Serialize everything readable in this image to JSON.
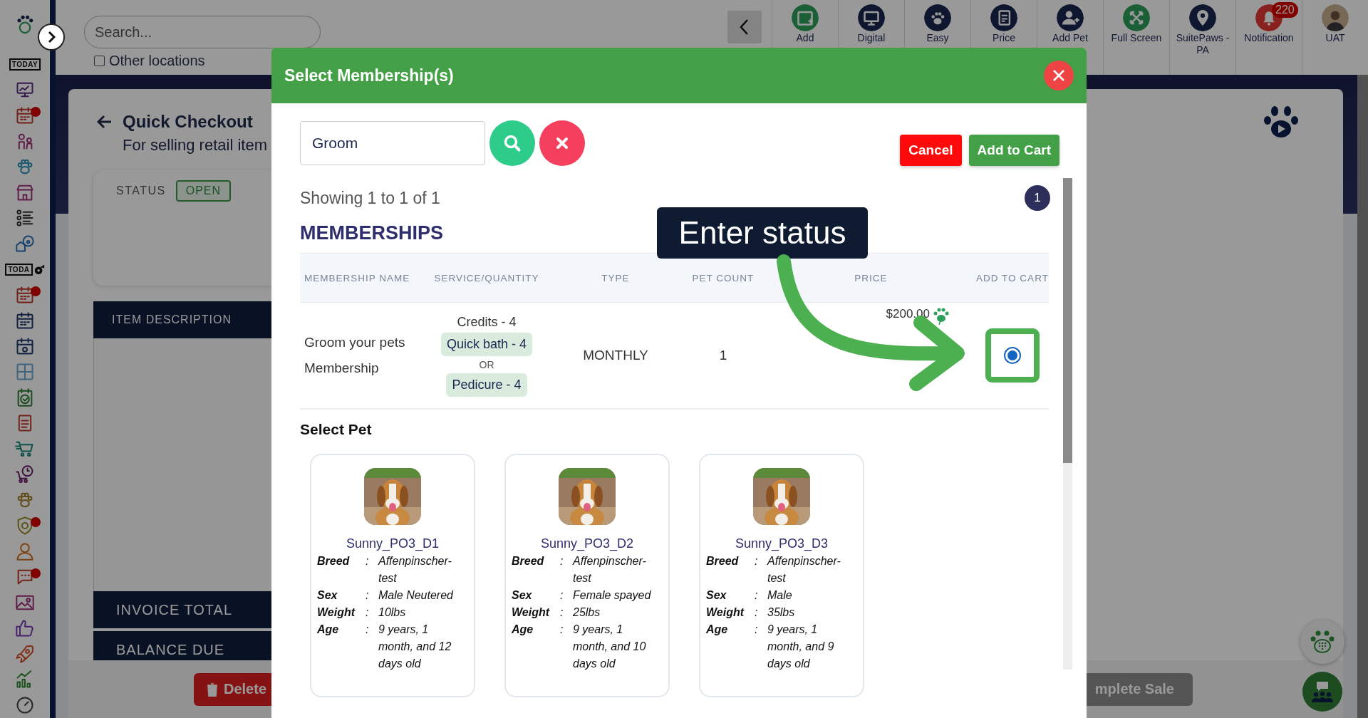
{
  "sidebar": {
    "items": [
      {
        "kind": "label",
        "text": "TODAY",
        "alert": false
      },
      {
        "kind": "icon",
        "alert": false
      },
      {
        "kind": "icon",
        "alert": true
      },
      {
        "kind": "icon",
        "alert": false
      },
      {
        "kind": "icon",
        "alert": false
      },
      {
        "kind": "icon",
        "alert": false
      },
      {
        "kind": "icon",
        "alert": false
      },
      {
        "kind": "icon",
        "alert": false
      },
      {
        "kind": "label",
        "text": "TODA",
        "alert": false
      },
      {
        "kind": "icon",
        "alert": true
      },
      {
        "kind": "icon",
        "alert": false
      },
      {
        "kind": "icon",
        "alert": false
      },
      {
        "kind": "icon",
        "alert": false
      },
      {
        "kind": "icon",
        "alert": false
      },
      {
        "kind": "icon",
        "alert": false
      },
      {
        "kind": "icon",
        "alert": false
      },
      {
        "kind": "icon",
        "alert": false
      },
      {
        "kind": "icon",
        "alert": false
      },
      {
        "kind": "icon",
        "alert": true
      },
      {
        "kind": "icon",
        "alert": false
      },
      {
        "kind": "icon",
        "alert": true
      },
      {
        "kind": "icon",
        "alert": false
      },
      {
        "kind": "icon",
        "alert": false
      },
      {
        "kind": "icon",
        "alert": false
      },
      {
        "kind": "icon",
        "alert": false
      },
      {
        "kind": "icon",
        "alert": false
      }
    ]
  },
  "topbar": {
    "search": {
      "placeholder": "Search..."
    },
    "other_locations": {
      "label": "Other locations",
      "checked": false
    },
    "toolbar": [
      {
        "label": "Add"
      },
      {
        "label": "Digital"
      },
      {
        "label": "Easy"
      },
      {
        "label": "Price"
      },
      {
        "label": "Add Pet"
      },
      {
        "label": "Full Screen"
      },
      {
        "label": "SuitePaws - PA"
      },
      {
        "label": "Notification",
        "badge": "220"
      },
      {
        "label": "UAT"
      }
    ]
  },
  "page": {
    "title": "Quick Checkout",
    "subtitle": "For selling retail item",
    "status_label": "STATUS",
    "status": "OPEN",
    "item_header": "ITEM DESCRIPTION",
    "totals": [
      "INVOICE TOTAL",
      "BALANCE DUE"
    ],
    "delete": "Delete",
    "complete": "mplete Sale"
  },
  "modal": {
    "title": "Select Membership(s)",
    "search": {
      "value": "Groom"
    },
    "buttons": [
      {
        "label": "Cancel",
        "kind": "danger"
      },
      {
        "label": "Add to Cart",
        "kind": "primary"
      }
    ],
    "showing": "Showing 1 to 1 of 1",
    "pages": [
      {
        "label": "1",
        "selected": true
      }
    ],
    "section_title": "MEMBERSHIPS",
    "table": {
      "columns": [
        "MEMBERSHIP NAME",
        "SERVICE/QUANTITY",
        "TYPE",
        "PET COUNT",
        "PRICE",
        "ADD TO CART"
      ],
      "rows": [
        {
          "name": "Groom your pets Membership",
          "credits": "Credits - 4",
          "services": [
            "Quick bath - 4",
            "Pedicure - 4"
          ],
          "separator": "OR",
          "type": "MONTHLY",
          "pet_count": "1",
          "price": "$200.00",
          "selected": true
        }
      ]
    },
    "callout": {
      "text": "Enter status"
    },
    "pets_title": "Select Pet",
    "pets": [
      {
        "name": "Sunny_PO3_D1",
        "fields": [
          {
            "label": "Breed",
            "sep": ":",
            "value": "Affenpinscher-test"
          },
          {
            "label": "Sex",
            "sep": ":",
            "value": "Male Neutered"
          },
          {
            "label": "Weight",
            "sep": ":",
            "value": "10lbs"
          },
          {
            "label": "Age",
            "sep": ":",
            "value": "9 years, 1 month, and 12 days old"
          }
        ]
      },
      {
        "name": "Sunny_PO3_D2",
        "fields": [
          {
            "label": "Breed",
            "sep": ":",
            "value": "Affenpinscher-test"
          },
          {
            "label": "Sex",
            "sep": ":",
            "value": "Female spayed"
          },
          {
            "label": "Weight",
            "sep": ":",
            "value": "25lbs"
          },
          {
            "label": "Age",
            "sep": ":",
            "value": "9 years, 1 month, and 10 days old"
          }
        ]
      },
      {
        "name": "Sunny_PO3_D3",
        "fields": [
          {
            "label": "Breed",
            "sep": ":",
            "value": "Affenpinscher-test"
          },
          {
            "label": "Sex",
            "sep": ":",
            "value": "Male"
          },
          {
            "label": "Weight",
            "sep": ":",
            "value": "35lbs"
          },
          {
            "label": "Age",
            "sep": ":",
            "value": "9 years, 1 month, and 9 days old"
          }
        ]
      }
    ]
  }
}
